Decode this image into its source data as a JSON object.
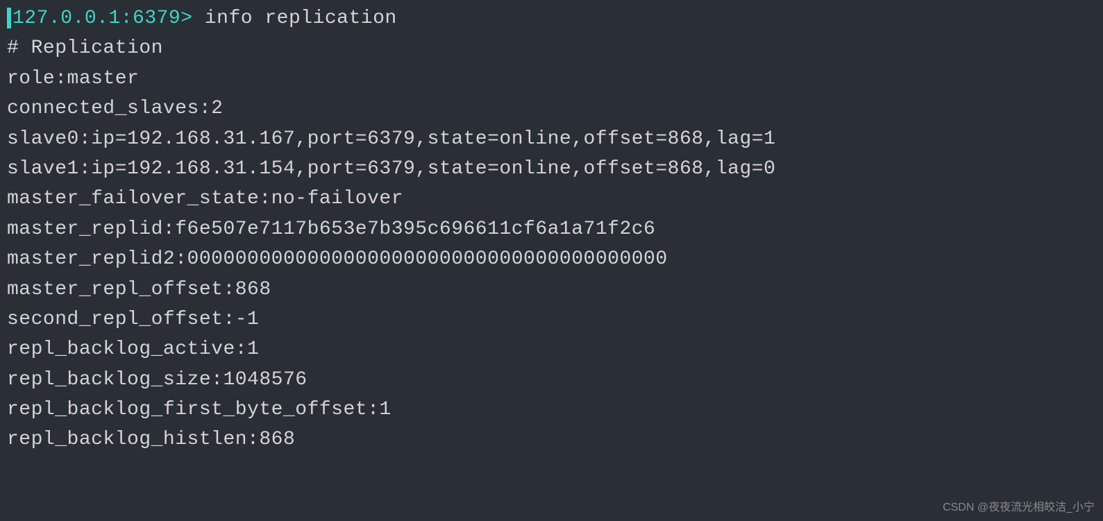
{
  "terminal": {
    "prompt": "127.0.0.1:6379> ",
    "command": "info replication",
    "output": {
      "header": "# Replication",
      "role": "role:master",
      "connected_slaves": "connected_slaves:2",
      "slave0": "slave0:ip=192.168.31.167,port=6379,state=online,offset=868,lag=1",
      "slave1": "slave1:ip=192.168.31.154,port=6379,state=online,offset=868,lag=0",
      "master_failover_state": "master_failover_state:no-failover",
      "master_replid": "master_replid:f6e507e7117b653e7b395c696611cf6a1a71f2c6",
      "master_replid2": "master_replid2:0000000000000000000000000000000000000000",
      "master_repl_offset": "master_repl_offset:868",
      "second_repl_offset": "second_repl_offset:-1",
      "repl_backlog_active": "repl_backlog_active:1",
      "repl_backlog_size": "repl_backlog_size:1048576",
      "repl_backlog_first_byte_offset": "repl_backlog_first_byte_offset:1",
      "repl_backlog_histlen": "repl_backlog_histlen:868"
    }
  },
  "watermark": "CSDN @夜夜流光相皎洁_小宁"
}
